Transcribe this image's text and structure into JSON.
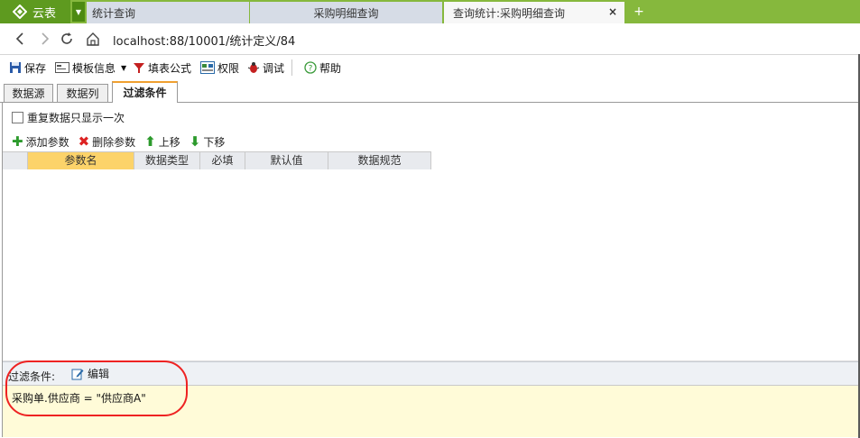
{
  "browser": {
    "app_name": "云表",
    "tabs": [
      {
        "label": "统计查询"
      },
      {
        "label": "采购明细查询"
      },
      {
        "label": "查询统计:采购明细查询",
        "close": "×",
        "active": true
      }
    ],
    "new_tab": "+",
    "url": "localhost:88/10001/统计定义/84"
  },
  "toolbar": {
    "save": "保存",
    "template_info": "模板信息",
    "fill_formula": "填表公式",
    "permission": "权限",
    "debug": "调试",
    "help": "帮助"
  },
  "inner_tabs": [
    {
      "label": "数据源"
    },
    {
      "label": "数据列"
    },
    {
      "label": "过滤条件",
      "active": true
    }
  ],
  "panel": {
    "checkbox_label": "重复数据只显示一次",
    "checkbox_checked": false,
    "actions": {
      "add": "添加参数",
      "delete": "删除参数",
      "up": "上移",
      "down": "下移"
    },
    "grid_columns": [
      "参数名",
      "数据类型",
      "必填",
      "默认值",
      "数据规范"
    ],
    "filter_label": "过滤条件:",
    "edit_label": "编辑",
    "filter_expression": "采购单.供应商 = \"供应商A\""
  },
  "colors": {
    "tabbar": "#86b83d",
    "selected_header": "#fcd36a",
    "filter_body": "#fffbd8",
    "highlight_circle": "#e22222"
  }
}
